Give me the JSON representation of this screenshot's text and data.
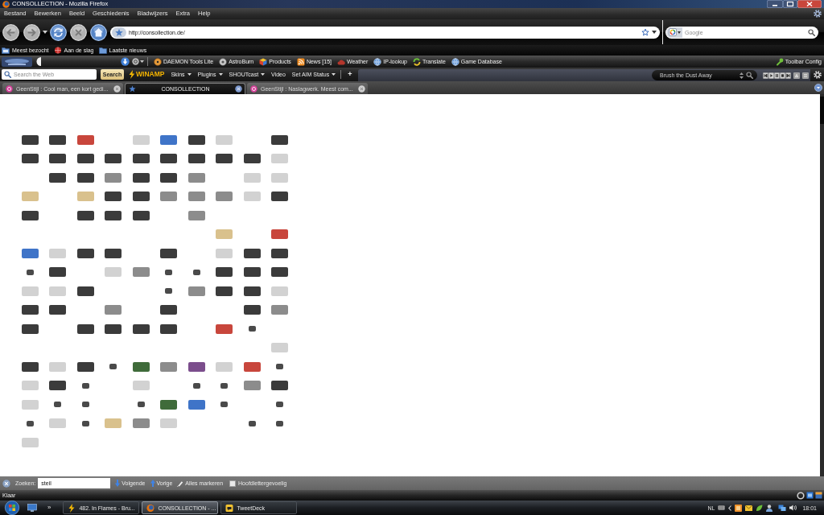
{
  "window": {
    "title": "CONSOLLECTION - Mozilla Firefox"
  },
  "menu_bar": {
    "items": [
      "Bestand",
      "Bewerken",
      "Beeld",
      "Geschiedenis",
      "Bladwijzers",
      "Extra",
      "Help"
    ]
  },
  "navigation": {
    "url": "http://consollection.de/",
    "search": {
      "placeholder": "Google"
    }
  },
  "bookmarks_bar": {
    "items": [
      "Meest bezocht",
      "Aan de slag",
      "Laatste nieuws"
    ]
  },
  "toolbar": {
    "items": [
      "DAEMON Tools Lite",
      "AstroBurn",
      "Products",
      "News [15]",
      "Weather",
      "IP-lookup",
      "Translate",
      "Game Database"
    ],
    "config": "Toolbar Config"
  },
  "winamp_toolbar": {
    "search": {
      "placeholder": "Search the Web"
    },
    "search_button": "Search",
    "logo": "WINAMP",
    "menus": [
      {
        "label": "Skins",
        "dropdown": true
      },
      {
        "label": "Plugins",
        "dropdown": true
      },
      {
        "label": "SHOUTcast",
        "dropdown": true
      },
      {
        "label": "Video",
        "dropdown": false
      },
      {
        "label": "Set AIM Status",
        "dropdown": true
      }
    ],
    "add_button": "+",
    "player": {
      "track": "Brush the Dust Away"
    }
  },
  "tabs": [
    {
      "title": "GeenStijl : Cool man, een kort gedi...",
      "selected": false
    },
    {
      "title": "CONSOLLECTION",
      "selected": true
    },
    {
      "title": "GeenStijl : Naslagwerk. Meest com...",
      "selected": false
    }
  ],
  "find_bar": {
    "label": "Zoeken:",
    "value": "steil",
    "next": "Volgende",
    "previous": "Vorige",
    "highlight_all": "Alles markeren",
    "match_case": {
      "label": "Hoofdlettergevoelig",
      "checked": false
    }
  },
  "status_bar": {
    "text": "Klaar"
  },
  "taskbar": {
    "more": "»",
    "tasks": [
      {
        "title": "482. In Flames - Bru...",
        "selected": false
      },
      {
        "title": "CONSOLLECTION - ...",
        "selected": true
      },
      {
        "title": "TweetDeck",
        "selected": false
      }
    ],
    "tray": {
      "language": "NL",
      "clock": "18:01"
    }
  }
}
